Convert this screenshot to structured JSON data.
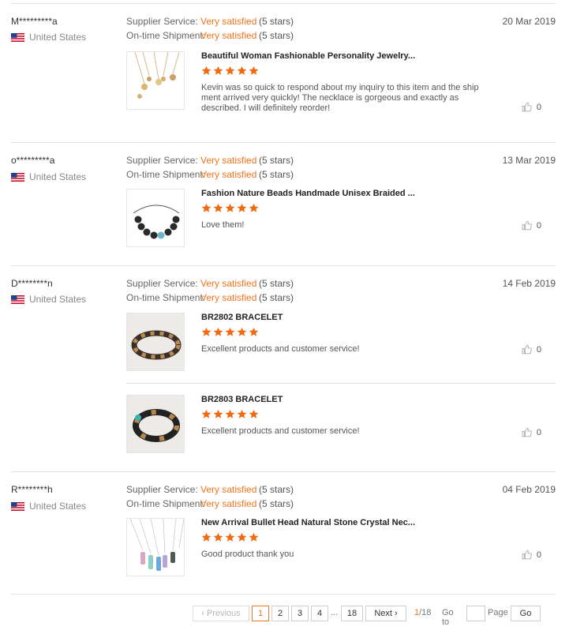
{
  "labels": {
    "supplier_service": "Supplier Service:",
    "ontime_shipment": "On-time Shipment:",
    "very_satisfied": "Very satisfied",
    "five_stars": "(5 stars)"
  },
  "colors": {
    "accent": "#f5731b",
    "star": "#f26a10",
    "border": "#e3e3e3"
  },
  "reviews": [
    {
      "buyer": "M*********a",
      "country": "United States",
      "date": "20 Mar 2019",
      "products": [
        {
          "title": "Beautiful Woman Fashionable Personality Jewelry...",
          "stars": 5,
          "text": "Kevin was so quick to respond about my inquiry to this item and the ship ment arrived very quickly! The necklace is gorgeous and exactly as described. I will definitely reorder!",
          "likes": "0"
        }
      ]
    },
    {
      "buyer": "o*********a",
      "country": "United States",
      "date": "13 Mar 2019",
      "products": [
        {
          "title": "Fashion Nature Beads Handmade Unisex Braided ...",
          "stars": 5,
          "text": "Love them!",
          "likes": "0"
        }
      ]
    },
    {
      "buyer": "D********n",
      "country": "United States",
      "date": "14 Feb 2019",
      "products": [
        {
          "title": "BR2802 BRACELET",
          "stars": 5,
          "text": "Excellent products and customer service!",
          "likes": "0"
        },
        {
          "title": "BR2803 BRACELET",
          "stars": 5,
          "text": "Excellent products and customer service!",
          "likes": "0"
        }
      ]
    },
    {
      "buyer": "R********h",
      "country": "United States",
      "date": "04 Feb 2019",
      "products": [
        {
          "title": "New Arrival Bullet Head Natural Stone Crystal Nec...",
          "stars": 5,
          "text": "Good product thank you",
          "likes": "0"
        }
      ]
    }
  ],
  "pagination": {
    "previous": "Previous",
    "pages": [
      "1",
      "2",
      "3",
      "4"
    ],
    "ellipsis": "...",
    "last": "18",
    "next": "Next",
    "current": "1",
    "total": "/18",
    "goto_label": "Go to",
    "goto_value": "",
    "page_label": "Page",
    "go_button": "Go"
  }
}
